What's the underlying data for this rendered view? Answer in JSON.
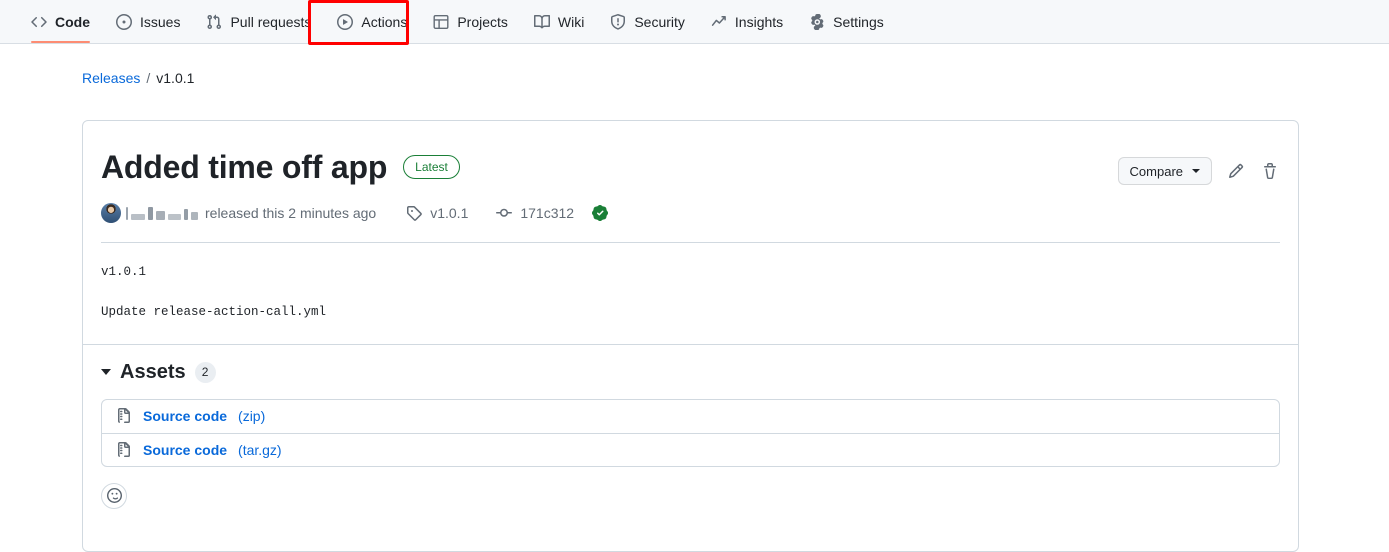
{
  "repo_nav": {
    "items": [
      {
        "label": "Code",
        "icon": "code-icon",
        "active": true
      },
      {
        "label": "Issues",
        "icon": "issue-opened-icon",
        "active": false
      },
      {
        "label": "Pull requests",
        "icon": "git-pull-request-icon",
        "active": false
      },
      {
        "label": "Actions",
        "icon": "play-icon",
        "active": false,
        "highlighted": true
      },
      {
        "label": "Projects",
        "icon": "table-icon",
        "active": false
      },
      {
        "label": "Wiki",
        "icon": "book-icon",
        "active": false
      },
      {
        "label": "Security",
        "icon": "shield-icon",
        "active": false
      },
      {
        "label": "Insights",
        "icon": "graph-icon",
        "active": false
      },
      {
        "label": "Settings",
        "icon": "gear-icon",
        "active": false
      }
    ],
    "highlight_color": "#ff0000",
    "active_underline_color": "#fd8c73",
    "background": "#f6f8fa"
  },
  "breadcrumb": {
    "parent": "Releases",
    "separator": "/",
    "current": "v1.0.1"
  },
  "release": {
    "title": "Added time off app",
    "latest_badge": "Latest",
    "latest_badge_color": "#1a7f37",
    "compare_label": "Compare",
    "edit_icon": "pencil-icon",
    "delete_icon": "trash-icon",
    "meta": {
      "avatar": "author-avatar",
      "author_redacted": true,
      "released_text": "released this 2 minutes ago",
      "tag_icon": "tag-icon",
      "tag": "v1.0.1",
      "commit_icon": "git-commit-icon",
      "commit": "171c312",
      "verified_icon": "verified-check-icon",
      "verified_color": "#1a7f37"
    },
    "body": [
      "v1.0.1",
      "Update release-action-call.yml"
    ]
  },
  "assets": {
    "label": "Assets",
    "count": "2",
    "caret": "triangle-down-icon",
    "items": [
      {
        "icon": "file-zip-icon",
        "name": "Source code",
        "ext": "(zip)"
      },
      {
        "icon": "file-zip-icon",
        "name": "Source code",
        "ext": "(tar.gz)"
      }
    ]
  },
  "reaction": {
    "icon": "smiley-icon"
  }
}
